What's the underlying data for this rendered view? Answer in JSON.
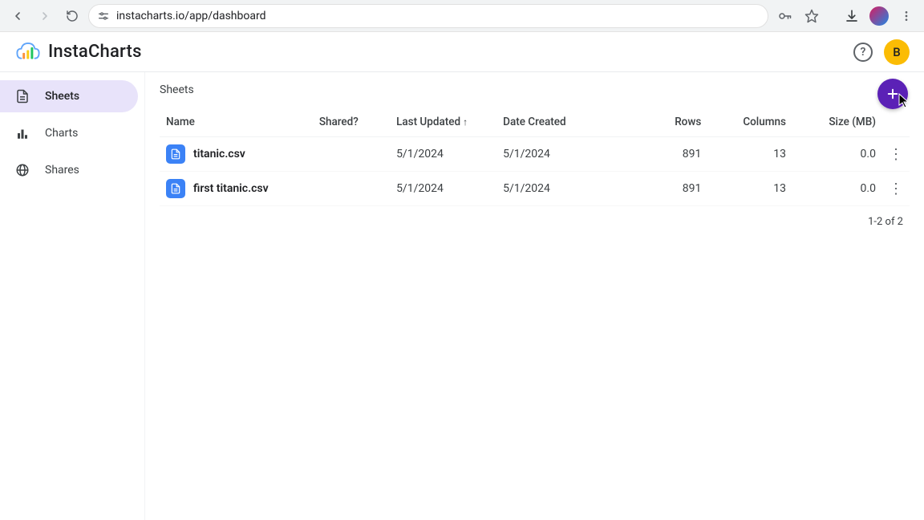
{
  "browser": {
    "url": "instacharts.io/app/dashboard"
  },
  "brand": "InstaCharts",
  "user_initial": "B",
  "sidebar": {
    "items": [
      {
        "label": "Sheets"
      },
      {
        "label": "Charts"
      },
      {
        "label": "Shares"
      }
    ]
  },
  "page": {
    "title": "Sheets"
  },
  "table": {
    "headers": {
      "name": "Name",
      "shared": "Shared?",
      "updated": "Last Updated",
      "created": "Date Created",
      "rows": "Rows",
      "columns": "Columns",
      "size": "Size (MB)"
    },
    "rows": [
      {
        "name": "titanic.csv",
        "shared": "",
        "updated": "5/1/2024",
        "created": "5/1/2024",
        "rows": "891",
        "columns": "13",
        "size": "0.0"
      },
      {
        "name": "first titanic.csv",
        "shared": "",
        "updated": "5/1/2024",
        "created": "5/1/2024",
        "rows": "891",
        "columns": "13",
        "size": "0.0"
      }
    ],
    "pager": "1-2 of 2"
  }
}
